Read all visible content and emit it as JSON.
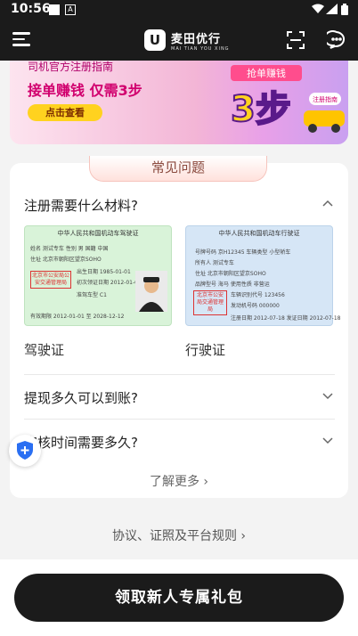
{
  "status_bar": {
    "time": "10:56",
    "notif_icon_2": "A"
  },
  "header": {
    "brand_cn": "麦田优行",
    "brand_en": "MAI TIAN YOU XING",
    "logo_letter": "U"
  },
  "banner": {
    "line1": "司机官方注册指南",
    "line2": "接单赚钱 仅需3步",
    "button": "点击查看",
    "art_tag": "抢单赚钱",
    "art_big": "3步",
    "art_badge": "注册指南"
  },
  "faq": {
    "title": "常见问题",
    "items": [
      {
        "question": "注册需要什么材料?",
        "expanded": true
      },
      {
        "question": "提现多久可以到账?",
        "expanded": false
      },
      {
        "question": "审核时间需要多久?",
        "expanded": false
      }
    ],
    "licenses": [
      {
        "caption": "驾驶证",
        "heading": "中华人民共和国机动车驾驶证",
        "rows": [
          "姓名 测试专车 性别 男 国籍 中国",
          "住址 北京市朝阳区望京SOHO",
          "出生日期 1985-01-01",
          "初次领证日期 2012-01-01",
          "准驾车型 C1",
          "有效期限 2012-01-01 至 2028-12-12"
        ],
        "stamp": "北京市公安局公安交通管理局"
      },
      {
        "caption": "行驶证",
        "heading": "中华人民共和国机动车行驶证",
        "rows": [
          "号牌号码 京H12345 车辆类型 小型轿车",
          "所有人 测试专车",
          "住址 北京市朝阳区望京SOHO",
          "品牌型号 海马 使用性质 非营运",
          "车辆识别代号 123456",
          "发动机号码 000000",
          "注册日期 2012-07-18 发证日期 2012-07-18"
        ],
        "stamp": "北京市公安局交通管理局"
      }
    ],
    "more": "了解更多 ›"
  },
  "rules_link": "协议、证照及平台规则 ›",
  "cta": "领取新人专属礼包",
  "colors": {
    "dark": "#1b1b1b",
    "banner_pink": "#d1006e",
    "accent_yellow": "#ffd21f"
  }
}
